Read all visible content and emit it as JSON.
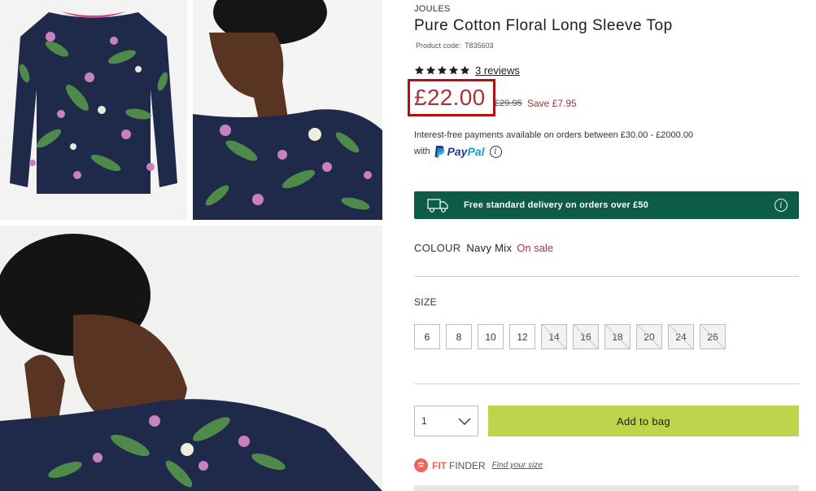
{
  "product": {
    "brand": "JOULES",
    "title": "Pure Cotton Floral Long Sleeve Top",
    "code_label": "Product code:",
    "code": "T835603",
    "rating_stars": 5,
    "reviews": "3 reviews",
    "price": "£22.00",
    "was_price": "£29.95",
    "save": "Save £7.95",
    "price_color": "#a8333a"
  },
  "payment": {
    "line1": "Interest-free payments available on orders between £30.00 - £2000.00",
    "with": "with",
    "paypal_pay": "Pay",
    "paypal_pal": "Pal",
    "info_glyph": "i"
  },
  "delivery": {
    "text": "Free standard delivery on orders over £50",
    "icon": "truck-icon",
    "info_glyph": "i",
    "bg_color": "#0d5c45"
  },
  "colour": {
    "label": "COLOUR",
    "value": "Navy Mix",
    "sale": "On sale"
  },
  "size": {
    "label": "SIZE",
    "options": [
      {
        "label": "6",
        "available": true
      },
      {
        "label": "8",
        "available": true
      },
      {
        "label": "10",
        "available": true
      },
      {
        "label": "12",
        "available": true
      },
      {
        "label": "14",
        "available": false
      },
      {
        "label": "16",
        "available": false
      },
      {
        "label": "18",
        "available": false
      },
      {
        "label": "20",
        "available": false
      },
      {
        "label": "24",
        "available": false
      },
      {
        "label": "26",
        "available": false
      }
    ]
  },
  "purchase": {
    "quantity": "1",
    "add_to_bag": "Add to bag",
    "button_color": "#bcd54d"
  },
  "fitfinder": {
    "fit": "FIT",
    "finder": "FINDER",
    "link": "Find your size"
  }
}
